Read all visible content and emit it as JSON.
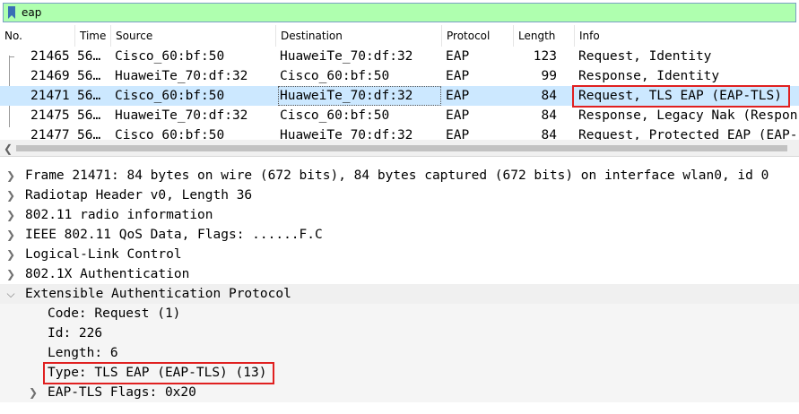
{
  "filter": {
    "value": "eap"
  },
  "packet_list": {
    "columns": [
      "No.",
      "Time",
      "Source",
      "Destination",
      "Protocol",
      "Length",
      "Info"
    ],
    "rows": [
      {
        "no": "21465",
        "time": "56…",
        "source": "Cisco_60:bf:50",
        "destination": "HuaweiTe_70:df:32",
        "protocol": "EAP",
        "length": "123",
        "info": "Request, Identity"
      },
      {
        "no": "21469",
        "time": "56…",
        "source": "HuaweiTe_70:df:32",
        "destination": "Cisco_60:bf:50",
        "protocol": "EAP",
        "length": "99",
        "info": "Response, Identity"
      },
      {
        "no": "21471",
        "time": "56…",
        "source": "Cisco_60:bf:50",
        "destination": "HuaweiTe_70:df:32",
        "protocol": "EAP",
        "length": "84",
        "info": "Request, TLS EAP (EAP-TLS)"
      },
      {
        "no": "21475",
        "time": "56…",
        "source": "HuaweiTe_70:df:32",
        "destination": "Cisco_60:bf:50",
        "protocol": "EAP",
        "length": "84",
        "info": "Response, Legacy Nak (Respon"
      },
      {
        "no": "21477",
        "time": "56…",
        "source": "Cisco_60:bf:50",
        "destination": "HuaweiTe_70:df:32",
        "protocol": "EAP",
        "length": "84",
        "info": "Request, Protected EAP (EAP-"
      }
    ]
  },
  "details": {
    "items": [
      {
        "label": "Frame 21471: 84 bytes on wire (672 bits), 84 bytes captured (672 bits) on interface wlan0, id 0"
      },
      {
        "label": "Radiotap Header v0, Length 36"
      },
      {
        "label": "802.11 radio information"
      },
      {
        "label": "IEEE 802.11 QoS Data, Flags: ......F.C"
      },
      {
        "label": "Logical-Link Control"
      },
      {
        "label": "802.1X Authentication"
      },
      {
        "label": "Extensible Authentication Protocol"
      }
    ],
    "eap_fields": [
      {
        "label": "Code: Request (1)"
      },
      {
        "label": "Id: 226"
      },
      {
        "label": "Length: 6"
      },
      {
        "label": "Type: TLS EAP (EAP-TLS) (13)"
      },
      {
        "label": "EAP-TLS Flags: 0x20"
      }
    ]
  },
  "colors": {
    "filter_bg": "#afffaf",
    "selected_row": "#cce8ff",
    "highlight": "#e02020"
  }
}
